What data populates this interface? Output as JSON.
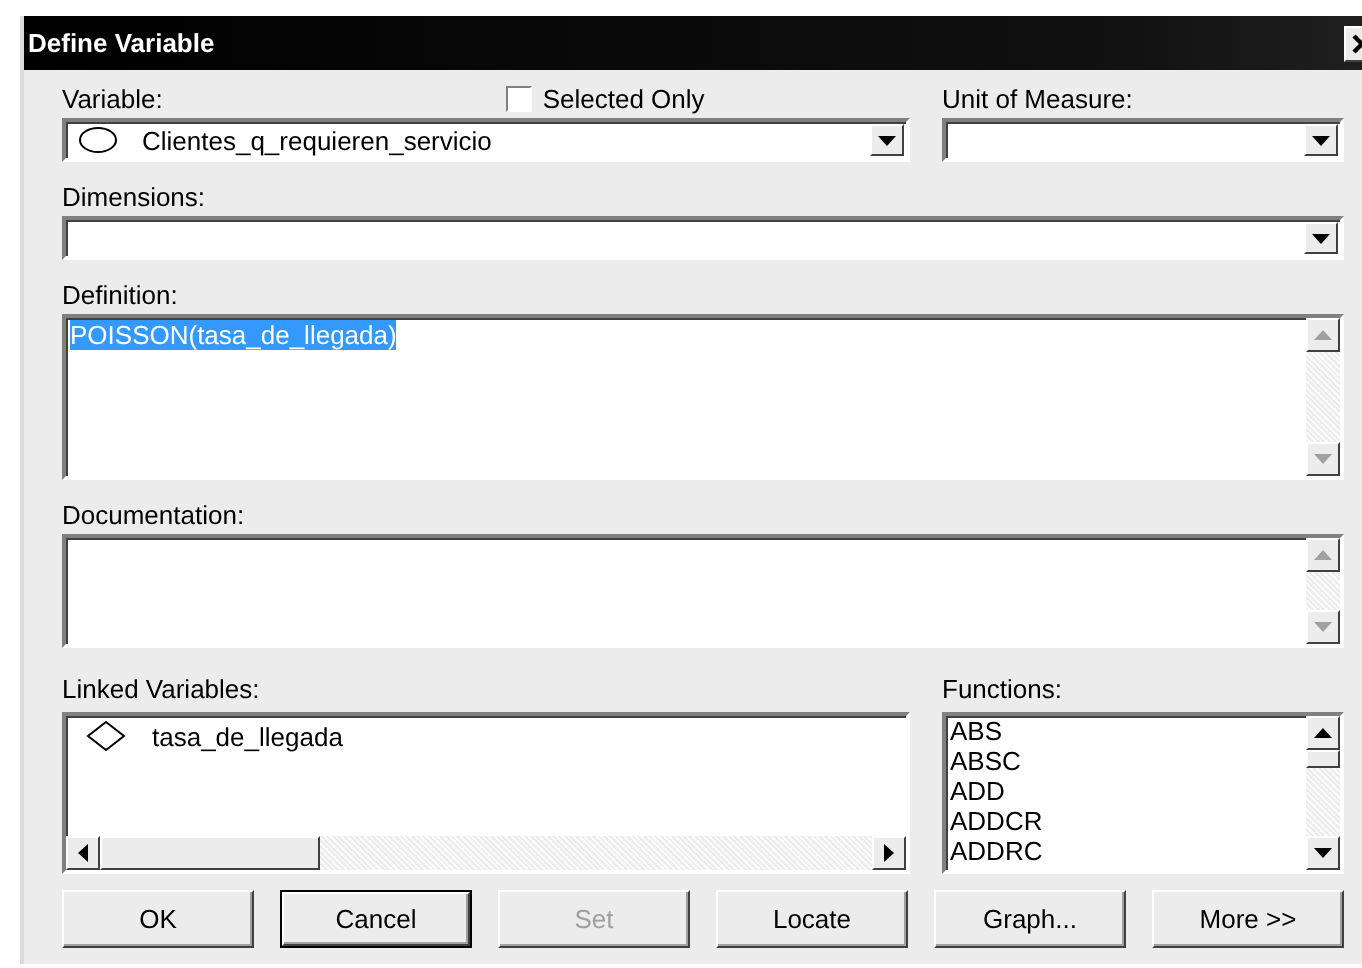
{
  "window": {
    "title": "Define Variable"
  },
  "variable": {
    "label": "Variable:",
    "value": "Clientes_q_requieren_servicio"
  },
  "selected_only": {
    "label": "Selected Only",
    "checked": false
  },
  "unit_of_measure": {
    "label": "Unit of Measure:"
  },
  "dimensions": {
    "label": "Dimensions:"
  },
  "definition": {
    "label": "Definition:",
    "value": "POISSON(tasa_de_llegada)",
    "selected": true
  },
  "documentation": {
    "label": "Documentation:"
  },
  "linked_variables": {
    "label": "Linked Variables:",
    "items": [
      "tasa_de_llegada"
    ]
  },
  "functions": {
    "label": "Functions:",
    "items": [
      "ABS",
      "ABSC",
      "ADD",
      "ADDCR",
      "ADDRC"
    ]
  },
  "buttons": [
    {
      "label": "OK",
      "disabled": false,
      "default": false
    },
    {
      "label": "Cancel",
      "disabled": false,
      "default": true
    },
    {
      "label": "Set",
      "disabled": true,
      "default": false
    },
    {
      "label": "Locate",
      "disabled": false,
      "default": false
    },
    {
      "label": "Graph...",
      "disabled": false,
      "default": false
    },
    {
      "label": "More >>",
      "disabled": false,
      "default": false
    }
  ]
}
